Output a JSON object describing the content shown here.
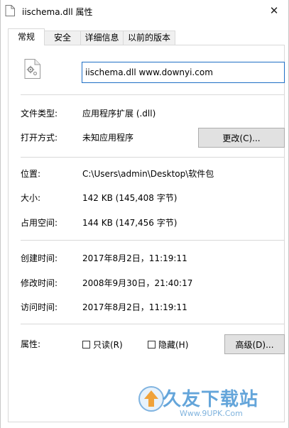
{
  "window": {
    "title": "iischema.dll 属性",
    "close_glyph": "✕"
  },
  "tabs": [
    {
      "label": "常规",
      "active": true
    },
    {
      "label": "安全",
      "active": false
    },
    {
      "label": "详细信息",
      "active": false
    },
    {
      "label": "以前的版本",
      "active": false
    }
  ],
  "general": {
    "file_name": "iischema.dll www.downyi.com",
    "file_type": {
      "label": "文件类型:",
      "value": "应用程序扩展 (.dll)"
    },
    "opens_with": {
      "label": "打开方式:",
      "value": "未知应用程序",
      "button": "更改(C)..."
    },
    "location": {
      "label": "位置:",
      "value": "C:\\Users\\admin\\Desktop\\软件包"
    },
    "size": {
      "label": "大小:",
      "value": "142 KB (145,408 字节)"
    },
    "size_on_disk": {
      "label": "占用空间:",
      "value": "144 KB (147,456 字节)"
    },
    "created": {
      "label": "创建时间:",
      "value": "2017年8月2日，11:19:11"
    },
    "modified": {
      "label": "修改时间:",
      "value": "2008年9月30日，21:40:17"
    },
    "accessed": {
      "label": "访问时间:",
      "value": "2017年8月2日，11:19:11"
    },
    "attributes": {
      "label": "属性:",
      "readonly": "只读(R)",
      "hidden": "隐藏(H)",
      "advanced_button": "高级(D)..."
    }
  },
  "watermark": {
    "text": "久友下载站",
    "url": "Www.9UPK.Com"
  },
  "colors": {
    "accent": "#1e6fc5",
    "watermark": "#4a96d4"
  }
}
